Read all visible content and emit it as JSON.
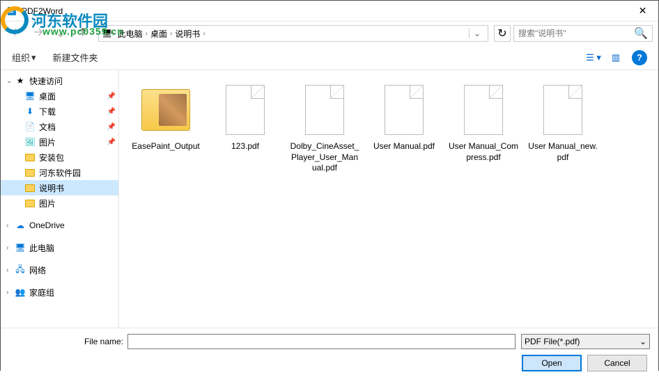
{
  "window": {
    "title": "PDF2Word"
  },
  "watermark": {
    "main": "河东软件园",
    "sub": "www.pc0359.cn"
  },
  "breadcrumb": {
    "items": [
      "此电脑",
      "桌面",
      "说明书"
    ]
  },
  "search": {
    "placeholder": "搜索\"说明书\""
  },
  "toolbar": {
    "organize": "组织",
    "new_folder": "新建文件夹"
  },
  "tree": {
    "quick_access": "快速访问",
    "desktop": "桌面",
    "downloads": "下载",
    "documents": "文档",
    "pictures": "图片",
    "install_pkg": "安装包",
    "hedong": "河东软件园",
    "shuomingshu": "说明书",
    "pictures2": "图片",
    "onedrive": "OneDrive",
    "this_pc": "此电脑",
    "network": "网络",
    "homegroup": "家庭组"
  },
  "files": [
    {
      "name": "EasePaint_Output",
      "type": "folder"
    },
    {
      "name": "123.pdf",
      "type": "doc"
    },
    {
      "name": "Dolby_CineAsset_Player_User_Manual.pdf",
      "type": "doc"
    },
    {
      "name": "User Manual.pdf",
      "type": "doc"
    },
    {
      "name": "User Manual_Compress.pdf",
      "type": "doc"
    },
    {
      "name": "User Manual_new.pdf",
      "type": "doc"
    }
  ],
  "bottom": {
    "file_name_label": "File name:",
    "file_name_value": "",
    "filter": "PDF File(*.pdf)",
    "open": "Open",
    "cancel": "Cancel"
  }
}
